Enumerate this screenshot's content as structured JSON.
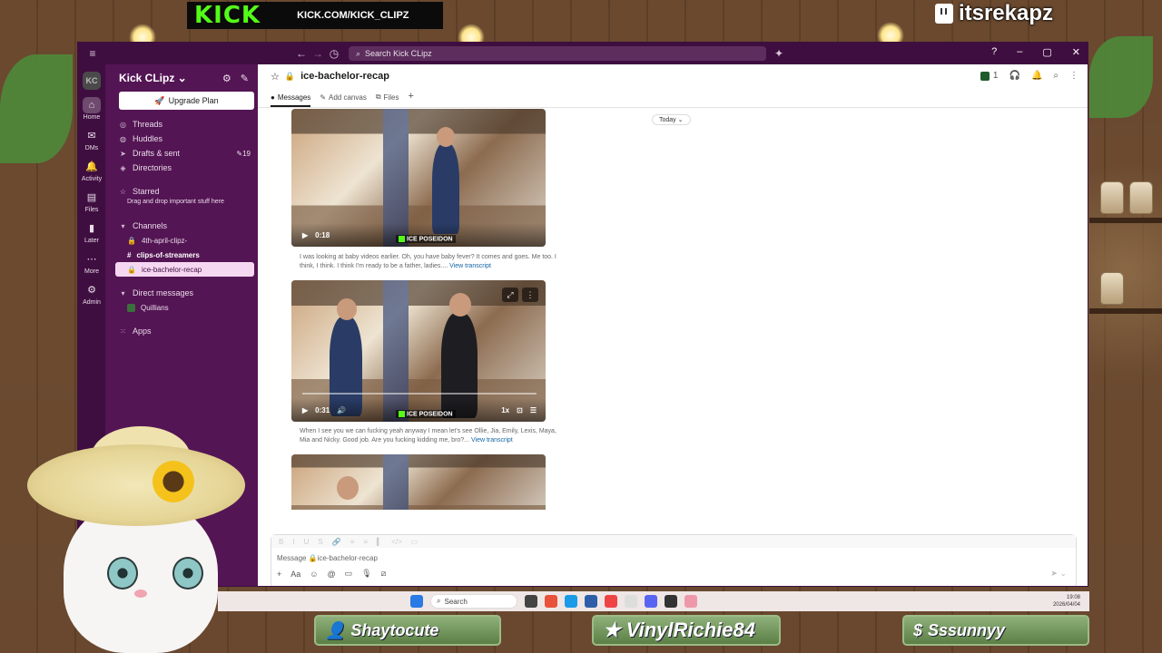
{
  "overlay": {
    "kick_logo": "KICK",
    "kick_url": "KICK.COM/KICK_CLIPZ",
    "twitch_handle": "itsrekapz",
    "latest_sub": "Shaytocute",
    "latest_gift": "VinylRichie84",
    "latest_tip": "Sssunnyy"
  },
  "titlebar": {
    "search_placeholder": "Search Kick CLipz"
  },
  "rail": {
    "workspace_initials": "KC",
    "items": [
      {
        "label": "Home",
        "icon": "home-icon"
      },
      {
        "label": "DMs",
        "icon": "dm-icon"
      },
      {
        "label": "Activity",
        "icon": "bell-icon"
      },
      {
        "label": "Files",
        "icon": "files-icon"
      },
      {
        "label": "Later",
        "icon": "bookmark-icon"
      },
      {
        "label": "More",
        "icon": "more-icon"
      },
      {
        "label": "Admin",
        "icon": "gear-icon"
      }
    ]
  },
  "sidebar": {
    "workspace_name": "Kick CLipz",
    "upgrade_label": "Upgrade Plan",
    "nav": [
      {
        "label": "Threads",
        "icon": "threads-icon"
      },
      {
        "label": "Huddles",
        "icon": "headphones-icon"
      },
      {
        "label": "Drafts & sent",
        "icon": "send-icon",
        "count": "19"
      },
      {
        "label": "Directories",
        "icon": "directory-icon"
      }
    ],
    "starred_label": "Starred",
    "starred_hint": "Drag and drop important stuff here",
    "channels_label": "Channels",
    "channels": [
      {
        "label": "4th-april-clipz-",
        "prefix": "🔒",
        "bold": false,
        "active": false
      },
      {
        "label": "clips-of-streamers",
        "prefix": "#",
        "bold": true,
        "active": false
      },
      {
        "label": "ice-bachelor-recap",
        "prefix": "🔒",
        "bold": false,
        "active": true
      }
    ],
    "dm_label": "Direct messages",
    "dm_users": [
      "Quillians"
    ],
    "apps_label": "Apps"
  },
  "channel": {
    "title": "ice-bachelor-recap",
    "member_count": "1",
    "tabs": [
      "Messages",
      "Add canvas",
      "Files"
    ],
    "date_divider": "Today"
  },
  "messages": [
    {
      "duration": "0:18",
      "watermark": "ICE POSEIDON",
      "caption": "I was looking at baby videos earlier. Oh, you have baby fever? It comes and goes. Me too. I think, I think. I think I'm ready to be a father, ladies....",
      "link": "View transcript"
    },
    {
      "duration": "0:31",
      "speed": "1x",
      "watermark": "ICE POSEIDON",
      "caption": "When I see you we can fucking yeah anyway I mean let's see Ollie, Jia, Emily, Lexis, Maya, Mia and Nicky. Good job. Are you fucking kidding me, bro?...",
      "link": "View transcript"
    }
  ],
  "composer": {
    "placeholder": "Message 🔒ice-bachelor-recap"
  },
  "taskbar": {
    "search_label": "Search",
    "time": "19:08",
    "date": "2026/04/04"
  }
}
